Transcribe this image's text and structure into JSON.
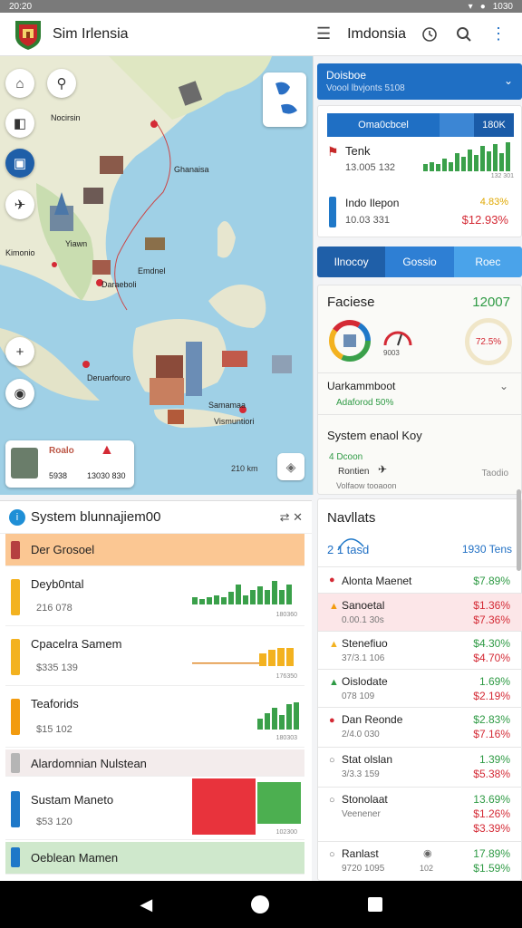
{
  "status": {
    "time": "20:20",
    "battery": "1030"
  },
  "app": {
    "title": "Sim Irlensia",
    "region": "Imdonsia"
  },
  "map": {
    "labels": [
      "Nocirsin",
      "Ghanaisa",
      "Kimonio",
      "Emdnel",
      "Daraeboli",
      "Deruarfouro",
      "Samamaa",
      "Vismuntiori",
      "Yiawn"
    ],
    "card": {
      "title": "Roalo",
      "value1": "5938",
      "value2": "13030 830"
    },
    "scale": "210 km"
  },
  "lpanel": {
    "title": "System blunnajiem00",
    "head_icons": "⇄ ✕",
    "rows": [
      {
        "name": "Der Grosoel",
        "sub": "",
        "color": "#b54040",
        "bg": "#fbc793"
      },
      {
        "name": "Deyb0ntal",
        "sub": "216 078",
        "color": "#f3b220",
        "bg": "#ffffff",
        "chart_label": "180360"
      },
      {
        "name": "Cpacelra Samem",
        "sub": "$335 139",
        "color": "#f3b220",
        "bg": "#ffffff",
        "chart_label": "176350"
      },
      {
        "name": "Teaforids",
        "sub": "$15 102",
        "color": "#f29b0f",
        "bg": "#ffffff",
        "chart_label": "180303"
      },
      {
        "name": "Alardomnian Nulstean",
        "sub": "",
        "color": "#b5b5b5",
        "bg": "#f3ecec"
      },
      {
        "name": "Sustam Maneto",
        "sub": "$53 120",
        "color": "#1f78c8",
        "bg": "#ffffff",
        "chart_label": "102300"
      },
      {
        "name": "Oeblean Mamen",
        "sub": "",
        "color": "#1f78c8",
        "bg": "#cfe8cc"
      }
    ]
  },
  "right": {
    "dropdown": {
      "title": "Doisboe",
      "sub": "Voool lbvjonts 5108"
    },
    "topcard": {
      "seg": [
        "Oma0cbcel",
        "",
        "180K"
      ],
      "r1": {
        "name": "Tenk",
        "sub": "13.005 132",
        "tiny": "132 301"
      },
      "r2": {
        "name": "Indo Ilepon",
        "sub": "10.03 331",
        "pct": "4.83%",
        "val": "$12.93%"
      }
    },
    "tabs": [
      "Ilnocoy",
      "Gossio",
      "Roec"
    ],
    "faciese": {
      "title": "Faciese",
      "value": "12007",
      "gauge_label": "9003",
      "ring": "72.5%",
      "r1": "Uarkammboot",
      "r1sub": "Adaforod 50%",
      "r2": "System enaol Koy",
      "r2a": "4 Dcoon",
      "r2b": "Rontien",
      "r2c": "Volfaow tooaoon",
      "r2right": "Taodio"
    },
    "markets": {
      "title": "Navllats",
      "left": "2 1 tasd",
      "right": "1930 Tens",
      "rows": [
        {
          "name": "Alonta Maenet",
          "sub": "",
          "v1": "$7.89%",
          "v2": "",
          "icon": "●",
          "iconcolor": "#d42a35"
        },
        {
          "name": "Sanoetal",
          "sub": "0.00.1 30s",
          "v1": "$1.36%",
          "v2": "$7.36%",
          "icon": "▲",
          "iconcolor": "#f29b0f",
          "hl": true
        },
        {
          "name": "Stenefiuo",
          "sub": "37/3.1 106",
          "v1": "$4.30%",
          "v2": "$4.70%",
          "icon": "▲",
          "iconcolor": "#f3b220"
        },
        {
          "name": "Oislodate",
          "sub": "078 109",
          "v1": "1.69%",
          "v2": "$2.19%",
          "icon": "▲",
          "iconcolor": "#2e9a44"
        },
        {
          "name": "Dan Reonde",
          "sub": "2/4.0 030",
          "v1": "$2.83%",
          "v2": "$7.16%",
          "icon": "●",
          "iconcolor": "#d42a35"
        },
        {
          "name": "Stat olslan",
          "sub": "3/3.3 159",
          "v1": "1.39%",
          "v2": "$5.38%",
          "icon": "●",
          "iconcolor": "#666"
        },
        {
          "name": "Stonolaat",
          "sub": "Veenener",
          "v1": "13.69%",
          "v2": "$1.26%",
          "v3": "$3.39%",
          "icon": "●",
          "iconcolor": "#666"
        },
        {
          "name": "Ranlast",
          "sub": "9720 1095",
          "mid": "102",
          "v1": "17.89%",
          "v2": "$1.59%",
          "icon": "●",
          "iconcolor": "#666"
        }
      ]
    }
  }
}
